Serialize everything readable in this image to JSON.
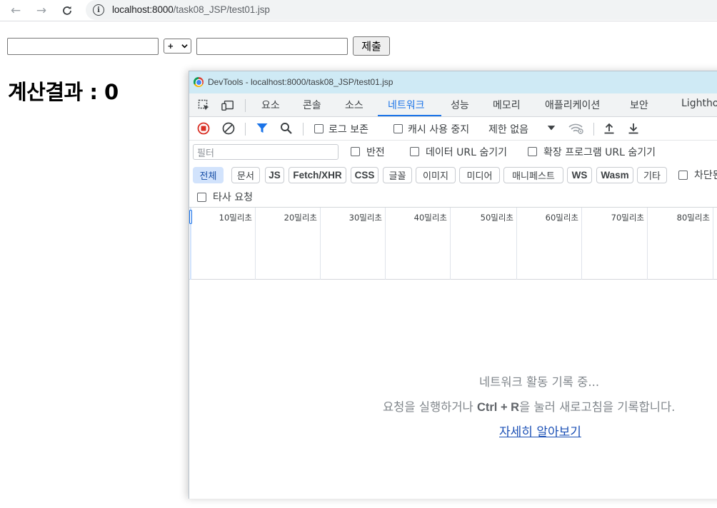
{
  "browser": {
    "url_host": "localhost:8000",
    "url_path": "/task08_JSP/test01.jsp"
  },
  "page": {
    "operand1": "",
    "operator_selected": "+",
    "operand2": "",
    "submit_label": "제출",
    "result_text": "계산결과 : 0"
  },
  "devtools": {
    "window_title": "DevTools - localhost:8000/task08_JSP/test01.jsp",
    "tabs": [
      "요소",
      "콘솔",
      "소스",
      "네트워크",
      "성능",
      "메모리",
      "애플리케이션",
      "보안",
      "Lighthouse"
    ],
    "active_tab": "네트워크",
    "toolbar": {
      "preserve_log": "로그 보존",
      "disable_cache": "캐시 사용 중지",
      "throttling": "제한 없음"
    },
    "filter": {
      "placeholder": "필터",
      "invert": "반전",
      "hide_data_urls": "데이터 URL 숨기기",
      "hide_extension_urls": "확장 프로그램 URL 숨기기"
    },
    "type_chips": [
      "전체",
      "문서",
      "JS",
      "Fetch/XHR",
      "CSS",
      "글꼴",
      "이미지",
      "미디어",
      "매니페스트",
      "WS",
      "Wasm",
      "기타"
    ],
    "blocked_requests": "차단된 요청",
    "third_party": "타사 요청",
    "timeline_ticks": [
      "10밀리초",
      "20밀리초",
      "30밀리초",
      "40밀리초",
      "50밀리초",
      "60밀리초",
      "70밀리초",
      "80밀리초"
    ],
    "empty_state": {
      "recording": "네트워크 활동 기록 중...",
      "hint_prefix": "요청을 실행하거나 ",
      "hint_shortcut": "Ctrl + R",
      "hint_suffix": "을 눌러 새로고침을 기록합니다.",
      "learn_more": "자세히 알아보기"
    }
  }
}
